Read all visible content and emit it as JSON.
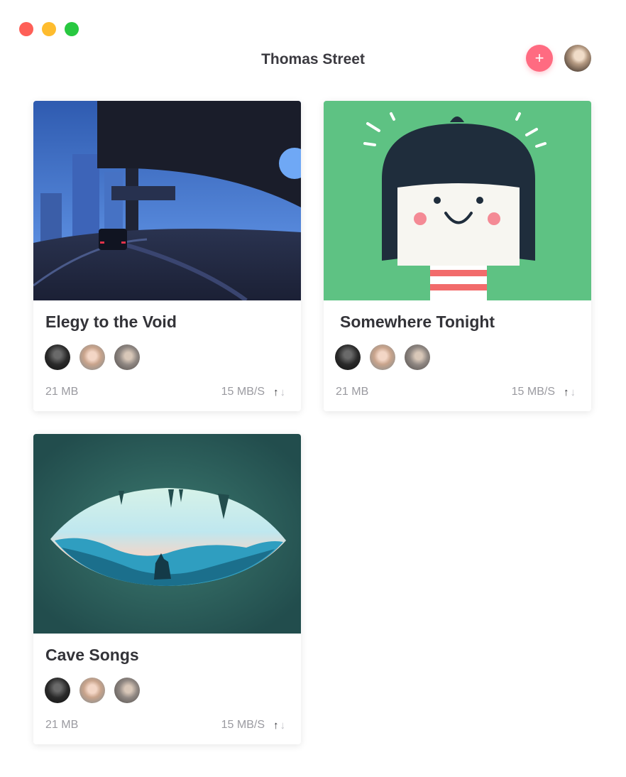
{
  "window": {
    "title": "Thomas Street"
  },
  "header": {
    "add_label": "+"
  },
  "cards": [
    {
      "name": "Elegy to the Void",
      "size": "21 MB",
      "rate": "15 MB/S",
      "upload_icon": "↑",
      "download_icon": "↓"
    },
    {
      "name": "Somewhere Tonight",
      "size": "21 MB",
      "rate": "15 MB/S",
      "upload_icon": "↑",
      "download_icon": "↓"
    },
    {
      "name": "Cave Songs",
      "size": "21 MB",
      "rate": "15 MB/S",
      "upload_icon": "↑",
      "download_icon": "↓"
    }
  ],
  "colors": {
    "accent": "#ff6b81",
    "close": "#fe5f57",
    "minimize": "#febc2e",
    "maximize": "#28c840",
    "green_art": "#5ec283",
    "cave_bg": "#224d4d"
  }
}
